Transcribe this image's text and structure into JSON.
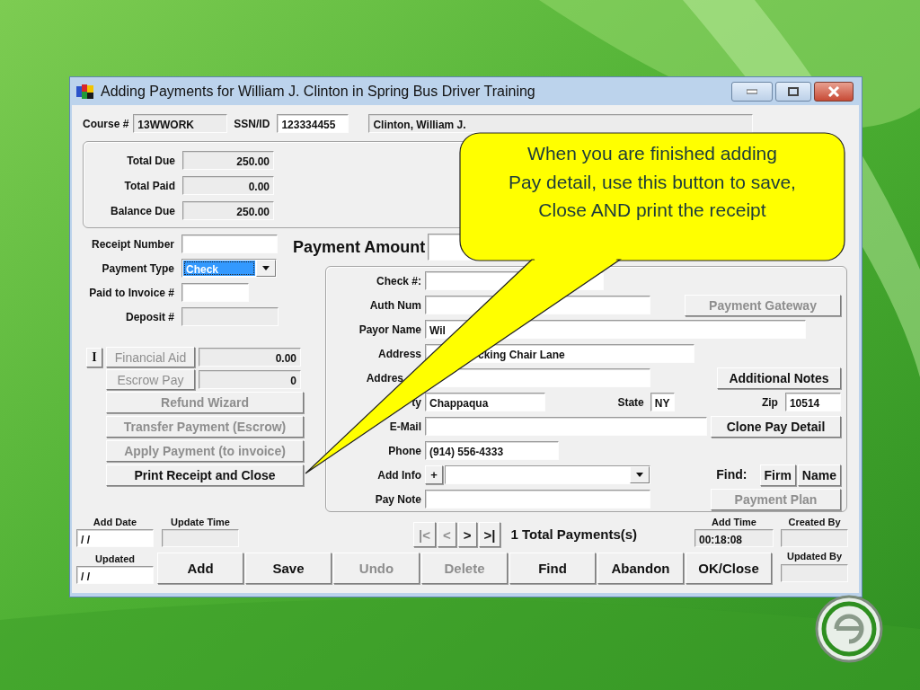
{
  "window": {
    "title": "Adding Payments for William J. Clinton in Spring Bus Driver Training"
  },
  "header": [
    {
      "label": "Course #",
      "value": "13WWORK",
      "readonly": true
    },
    {
      "label": "SSN/ID",
      "value": "123334455",
      "readonly": false
    },
    {
      "value": "Clinton, William J.",
      "readonly": true
    }
  ],
  "totals": [
    {
      "label": "Total Due",
      "value": "250.00"
    },
    {
      "label": "Total Paid",
      "value": "0.00"
    },
    {
      "label": "Balance Due",
      "value": "250.00"
    }
  ],
  "receipt_fields": [
    {
      "kind": "text",
      "label": "Receipt Number",
      "readonly": false
    },
    {
      "kind": "combo",
      "label": "Payment Type",
      "value": "Check",
      "highlighted": true
    },
    {
      "kind": "text",
      "label": "Paid to Invoice #",
      "readonly": false
    },
    {
      "kind": "text",
      "label": "Deposit #",
      "readonly": true
    }
  ],
  "funds": [
    {
      "info_button": "I",
      "button": "Financial Aid",
      "disabled": true,
      "value": "0.00"
    },
    {
      "button": "Escrow Pay",
      "disabled": true,
      "value": "0"
    }
  ],
  "actions": [
    {
      "label": "Refund Wizard",
      "disabled": true
    },
    {
      "label": "Transfer Payment (Escrow)",
      "disabled": true
    },
    {
      "label": "Apply Payment (to invoice)",
      "disabled": true
    },
    {
      "label": "Print Receipt and Close",
      "disabled": false
    }
  ],
  "payment_amount": {
    "label": "Payment Amount"
  },
  "detail_rows": [
    {
      "kind": "text",
      "label": "Check #:"
    },
    {
      "kind": "text",
      "label": "Auth Num",
      "side": {
        "kind": "button",
        "label": "Payment Gateway",
        "disabled": true
      }
    },
    {
      "kind": "text",
      "label": "Payor Name",
      "value": "Wil"
    },
    {
      "kind": "text",
      "label": "Address",
      "value": "cking Chair Lane"
    },
    {
      "kind": "text",
      "label": "Addres",
      "side": {
        "kind": "button",
        "label": "Additional Notes",
        "disabled": false
      }
    },
    {
      "kind": "address",
      "label": "ty",
      "value": "Chappaqua",
      "state_label": "State",
      "state": "NY",
      "zip_label": "Zip",
      "zip": "10514"
    },
    {
      "kind": "text",
      "label": "E-Mail",
      "side": {
        "kind": "button",
        "label": "Clone Pay Detail",
        "disabled": false
      }
    },
    {
      "kind": "text",
      "label": "Phone",
      "value": "(914) 556-4333"
    },
    {
      "kind": "combo",
      "label": "Add Info",
      "button": "+",
      "side": {
        "kind": "find",
        "label": "Find:",
        "buttons": [
          "Firm",
          "Name"
        ]
      }
    },
    {
      "kind": "text",
      "label": "Pay Note",
      "side": {
        "kind": "button",
        "label": "Payment Plan",
        "disabled": true
      }
    }
  ],
  "navigator": {
    "buttons": [
      {
        "label": "|<",
        "disabled": true
      },
      {
        "label": "<",
        "disabled": true
      },
      {
        "label": ">",
        "disabled": false
      },
      {
        "label": ">|",
        "disabled": false
      }
    ],
    "summary": "1 Total Payments(s)"
  },
  "audit": {
    "add_date": {
      "label": "Add Date",
      "value": "/ /",
      "readonly": false
    },
    "update_time": {
      "label": "Update Time",
      "readonly": true
    },
    "add_time": {
      "label": "Add Time",
      "value": "00:18:08",
      "readonly": true
    },
    "created_by": {
      "label": "Created By",
      "readonly": true
    },
    "updated": {
      "label": "Updated",
      "value": "/ /",
      "readonly": false
    },
    "updated_by": {
      "label": "Updated By",
      "readonly": true
    }
  },
  "toolbar": [
    {
      "label": "Add",
      "disabled": false
    },
    {
      "label": "Save",
      "disabled": false
    },
    {
      "label": "Undo",
      "disabled": true
    },
    {
      "label": "Delete",
      "disabled": true
    },
    {
      "label": "Find",
      "disabled": false
    },
    {
      "label": "Abandon",
      "disabled": false
    },
    {
      "label": "OK/Close",
      "disabled": false
    }
  ],
  "callout": {
    "text": "When you are finished adding\nPay detail, use this button to save,\nClose AND print the receipt"
  }
}
